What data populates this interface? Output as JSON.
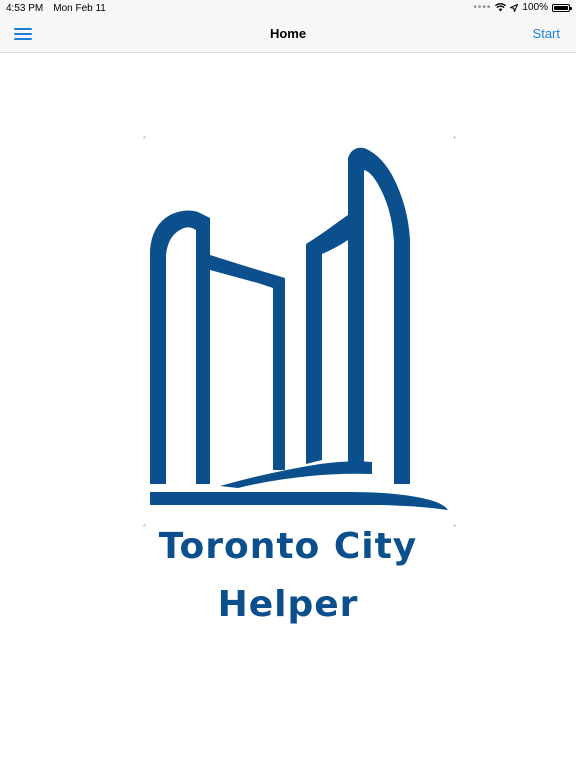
{
  "status_bar": {
    "time": "4:53 PM",
    "date": "Mon Feb 11",
    "battery": "100%"
  },
  "nav": {
    "title": "Home",
    "right_button": "Start"
  },
  "logo": {
    "line1": "Toronto City",
    "line2": "Helper",
    "color": "#0b4f8c"
  },
  "colors": {
    "accent": "#1a7fd9",
    "brand": "#0b4f8c"
  }
}
